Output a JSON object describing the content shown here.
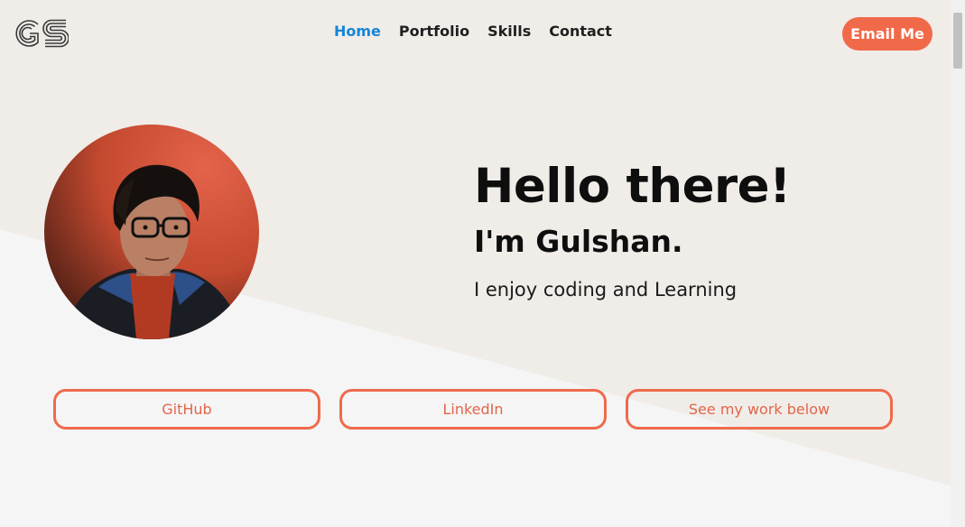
{
  "logo": {
    "text": "GS"
  },
  "nav": {
    "items": [
      {
        "label": "Home",
        "active": true
      },
      {
        "label": "Portfolio",
        "active": false
      },
      {
        "label": "Skills",
        "active": false
      },
      {
        "label": "Contact",
        "active": false
      }
    ]
  },
  "header": {
    "email_button": "Email Me"
  },
  "hero": {
    "greeting": "Hello there!",
    "name_line": "I'm Gulshan.",
    "tagline": "I enjoy coding and Learning"
  },
  "buttons": {
    "github": "GitHub",
    "linkedin": "LinkedIn",
    "work": "See my work below"
  },
  "colors": {
    "accent": "#f06a4a",
    "nav_active": "#1585d8",
    "background_upper": "#f0ece8",
    "background_lower": "#f5f5f5"
  }
}
